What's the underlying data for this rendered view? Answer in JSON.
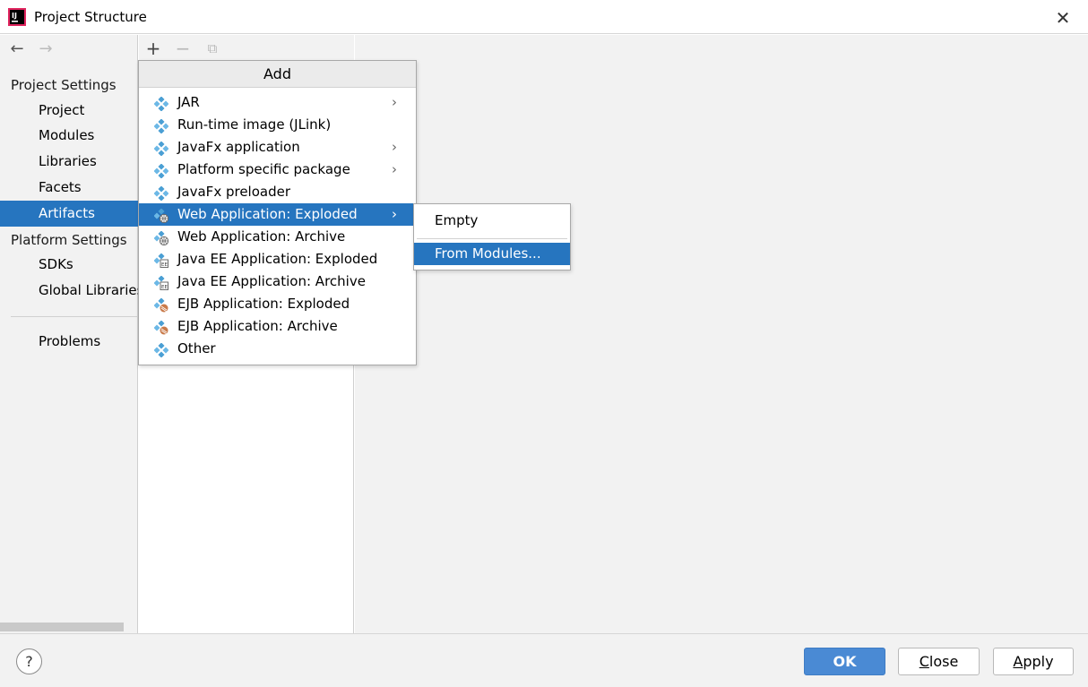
{
  "window": {
    "title": "Project Structure",
    "close_glyph": "✕",
    "logo_text": "IJ"
  },
  "sidebar": {
    "back_glyph": "←",
    "forward_glyph": "→",
    "project_settings_label": "Project Settings",
    "project_settings_items": [
      {
        "label": "Project"
      },
      {
        "label": "Modules"
      },
      {
        "label": "Libraries"
      },
      {
        "label": "Facets"
      },
      {
        "label": "Artifacts",
        "selected": true
      }
    ],
    "platform_settings_label": "Platform Settings",
    "platform_settings_items": [
      {
        "label": "SDKs"
      },
      {
        "label": "Global Libraries"
      }
    ],
    "problems_label": "Problems"
  },
  "toolbar": {
    "add_glyph": "+",
    "remove_glyph": "−",
    "copy_glyph": "⧉"
  },
  "add_menu": {
    "header": "Add",
    "arrow_glyph": "›",
    "items": [
      {
        "label": "JAR",
        "icon": "artifact-icon",
        "has_submenu": true
      },
      {
        "label": "Run-time image (JLink)",
        "icon": "artifact-icon",
        "has_submenu": false
      },
      {
        "label": "JavaFx application",
        "icon": "artifact-icon",
        "has_submenu": true
      },
      {
        "label": "Platform specific package",
        "icon": "artifact-icon",
        "has_submenu": true
      },
      {
        "label": "JavaFx preloader",
        "icon": "artifact-icon",
        "has_submenu": false
      },
      {
        "label": "Web Application: Exploded",
        "icon": "web-artifact-icon",
        "has_submenu": true,
        "selected": true
      },
      {
        "label": "Web Application: Archive",
        "icon": "web-artifact-icon",
        "has_submenu": false
      },
      {
        "label": "Java EE Application: Exploded",
        "icon": "javaee-artifact-icon",
        "has_submenu": false
      },
      {
        "label": "Java EE Application: Archive",
        "icon": "javaee-artifact-icon",
        "has_submenu": false
      },
      {
        "label": "EJB Application: Exploded",
        "icon": "ejb-artifact-icon",
        "has_submenu": false
      },
      {
        "label": "EJB Application: Archive",
        "icon": "ejb-artifact-icon",
        "has_submenu": false
      },
      {
        "label": "Other",
        "icon": "artifact-icon",
        "has_submenu": false
      }
    ]
  },
  "submenu": {
    "empty_label": "Empty",
    "from_modules_label": "From Modules..."
  },
  "footer": {
    "help_glyph": "?",
    "ok_label": "OK",
    "close_mnemonic": "C",
    "close_rest": "lose",
    "apply_mnemonic": "A",
    "apply_rest": "pply"
  },
  "colors": {
    "selection": "#2675bf",
    "panel_bg": "#f2f2f2",
    "ok_button": "#4a8ad4",
    "artifact_icon": "#4a9fd4"
  }
}
